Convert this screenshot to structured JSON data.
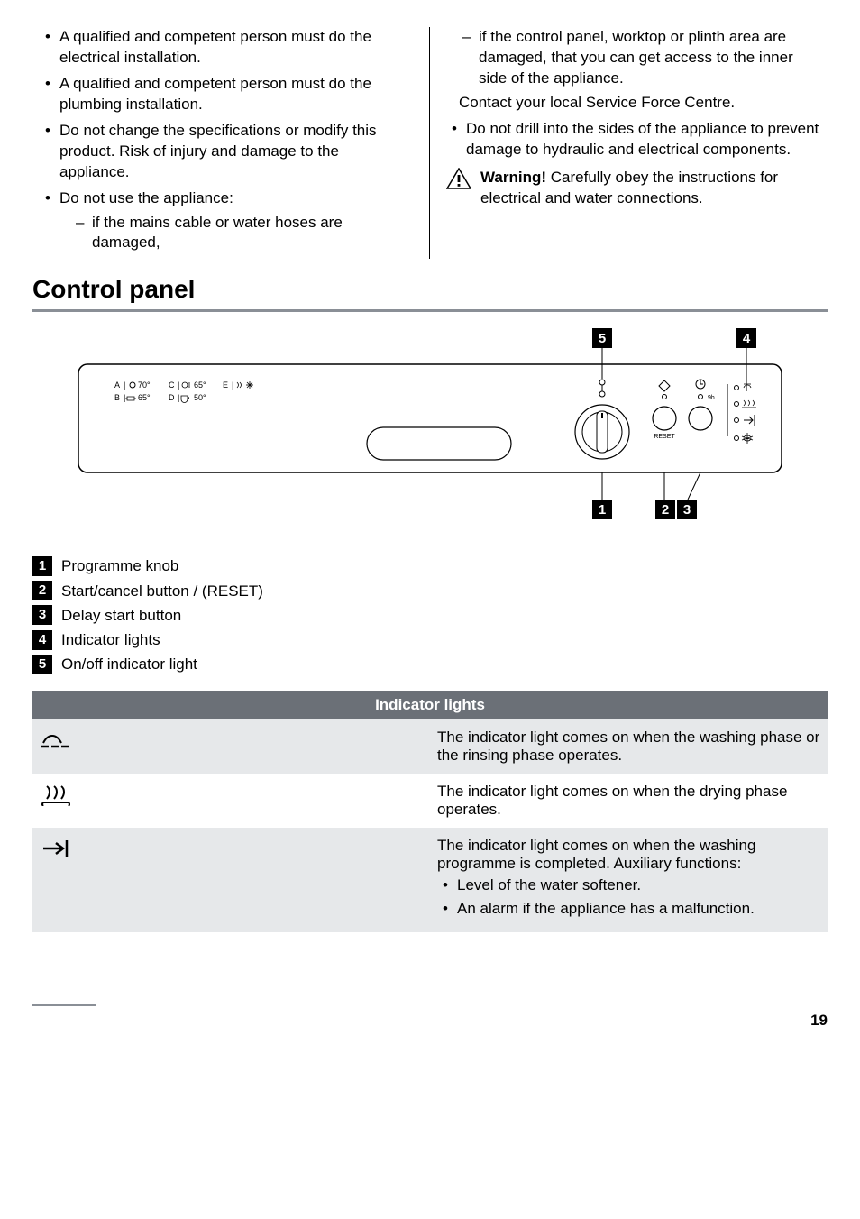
{
  "left_col": {
    "items": [
      "A qualified and competent person must do the electrical installation.",
      "A qualified and competent person must do the plumbing installation.",
      "Do not change the specifications or modify this product. Risk of injury and damage to the appliance.",
      "Do not use the appliance:"
    ],
    "sub_items": [
      "if the mains cable or water hoses are damaged,"
    ]
  },
  "right_col": {
    "sub_items": [
      "if the control panel, worktop or plinth area are damaged, that you can get access to the inner side of the appliance."
    ],
    "contact_line": "Contact your local Service Force Centre.",
    "items_after": [
      "Do not drill into the sides of the appliance to prevent damage to hydraulic and electrical components."
    ],
    "warning_label": "Warning!",
    "warning_text": "  Carefully obey the instructions for electrical and water connections."
  },
  "section_heading": "Control panel",
  "diagram": {
    "programmes": {
      "A": "70°",
      "B": "65°",
      "C": "65°",
      "D": "50°",
      "E": " "
    },
    "reset_label": "RESET",
    "delay_label": "9h",
    "callouts": {
      "1": "1",
      "2": "2",
      "3": "3",
      "4": "4",
      "5": "5"
    }
  },
  "legend": [
    {
      "num": "1",
      "text": "Programme knob"
    },
    {
      "num": "2",
      "text": "Start/cancel button / (RESET)"
    },
    {
      "num": "3",
      "text": "Delay start button"
    },
    {
      "num": "4",
      "text": "Indicator lights"
    },
    {
      "num": "5",
      "text": "On/off indicator light"
    }
  ],
  "table": {
    "header": "Indicator lights",
    "rows": [
      {
        "icon": "wash",
        "text": "The indicator light comes on when the washing phase or the rinsing phase operates."
      },
      {
        "icon": "dry",
        "text": "The indicator light comes on when the drying phase operates."
      },
      {
        "icon": "end",
        "text": "The indicator light comes on when the washing programme is completed. Auxiliary functions:",
        "bullets": [
          "Level of the water softener.",
          "An alarm if the appliance has a malfunction."
        ]
      }
    ]
  },
  "page_number": "19"
}
